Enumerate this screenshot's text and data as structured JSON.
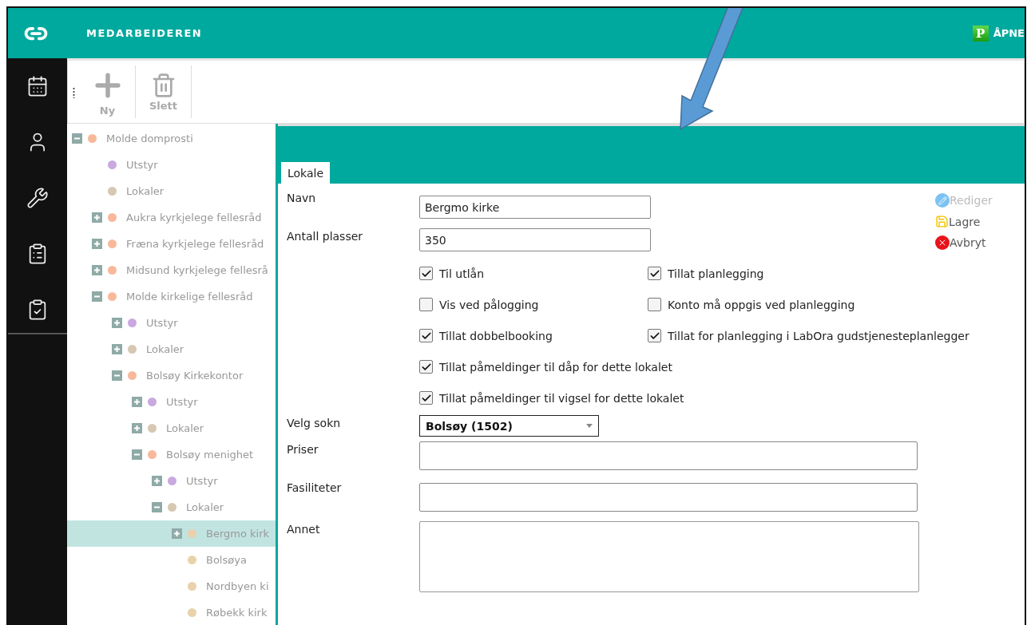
{
  "header": {
    "title": "MEDARBEIDEREN",
    "badge": "P",
    "action": "ÅPNE"
  },
  "toolbar": [
    {
      "kind": "add",
      "label": "Ny"
    },
    {
      "kind": "delete",
      "label": "Slett"
    }
  ],
  "sidebar": {
    "items": [
      {
        "kind": "calendar"
      },
      {
        "kind": "user"
      },
      {
        "kind": "wrench"
      },
      {
        "kind": "report"
      },
      {
        "kind": "checklist"
      }
    ]
  },
  "tree": [
    {
      "label": "Molde domprosti",
      "color": "#f8b99b",
      "expanded": true,
      "selected": false,
      "children": [
        {
          "label": "Utstyr",
          "color": "#c9a9e0",
          "selected": false
        },
        {
          "label": "Lokaler",
          "color": "#d6c8b2",
          "selected": false
        },
        {
          "label": "Aukra kyrkjelege fellesråd",
          "color": "#f8b99b",
          "expanded": false,
          "selected": false
        },
        {
          "label": "Fræna kyrkjelege fellesråd",
          "color": "#f8b99b",
          "expanded": false,
          "selected": false
        },
        {
          "label": "Midsund kyrkjelege fellesrå",
          "color": "#f8b99b",
          "expanded": false,
          "selected": false
        },
        {
          "label": "Molde kirkelige fellesråd",
          "color": "#f8b99b",
          "expanded": true,
          "selected": false,
          "children": [
            {
              "label": "Utstyr",
              "color": "#c9a9e0",
              "expanded": false,
              "selected": false
            },
            {
              "label": "Lokaler",
              "color": "#d6c8b2",
              "expanded": false,
              "selected": false
            },
            {
              "label": "Bolsøy Kirkekontor",
              "color": "#f8b99b",
              "expanded": true,
              "selected": false,
              "children": [
                {
                  "label": "Utstyr",
                  "color": "#c9a9e0",
                  "expanded": false,
                  "selected": false
                },
                {
                  "label": "Lokaler",
                  "color": "#d6c8b2",
                  "expanded": false,
                  "selected": false
                },
                {
                  "label": "Bolsøy menighet",
                  "color": "#f8b99b",
                  "expanded": true,
                  "selected": false,
                  "children": [
                    {
                      "label": "Utstyr",
                      "color": "#c9a9e0",
                      "expanded": false,
                      "selected": false
                    },
                    {
                      "label": "Lokaler",
                      "color": "#d6c8b2",
                      "expanded": true,
                      "selected": false,
                      "children": [
                        {
                          "label": "Bergmo kirk",
                          "color": "#e9d2ab",
                          "expanded": false,
                          "selected": true
                        },
                        {
                          "label": "Bolsøya",
                          "color": "#e9d2ab",
                          "selected": false
                        },
                        {
                          "label": "Nordbyen ki",
                          "color": "#e9d2ab",
                          "selected": false
                        },
                        {
                          "label": "Røbekk kirk",
                          "color": "#e9d2ab",
                          "selected": false
                        }
                      ]
                    }
                  ]
                }
              ]
            }
          ]
        }
      ]
    }
  ],
  "form": {
    "tabs": [
      {
        "label": "Lokale",
        "selected": true
      }
    ],
    "fields_top": [
      {
        "label": "Navn",
        "value": "Bergmo kirke"
      },
      {
        "label": "Antall plasser",
        "value": "350"
      }
    ],
    "actions": [
      {
        "kind": "edit",
        "label": "Rediger",
        "disabled": true
      },
      {
        "kind": "save",
        "label": "Lagre",
        "disabled": false
      },
      {
        "kind": "cancel",
        "label": "Avbryt",
        "disabled": false
      }
    ],
    "options": [
      {
        "label": "Til utlån",
        "checked": true,
        "wide": false
      },
      {
        "label": "Tillat planlegging",
        "checked": true,
        "wide": false
      },
      {
        "label": "Vis ved pålogging",
        "checked": false,
        "wide": false
      },
      {
        "label": "Konto må oppgis ved planlegging",
        "checked": false,
        "wide": false
      },
      {
        "label": "Tillat dobbelbooking",
        "checked": true,
        "wide": false
      },
      {
        "label": "Tillat for planlegging i LabOra gudstjenesteplanlegger",
        "checked": true,
        "wide": false
      },
      {
        "label": "Tillat påmeldinger til dåp for dette lokalet",
        "checked": true,
        "wide": true
      },
      {
        "label": "Tillat påmeldinger til vigsel for dette lokalet",
        "checked": true,
        "wide": true
      }
    ],
    "fields_bottom": [
      {
        "label": "Velg sokn",
        "kind": "select",
        "value": "Bolsøy (1502)"
      },
      {
        "label": "Priser",
        "kind": "text"
      },
      {
        "label": "Fasiliteter",
        "kind": "text"
      },
      {
        "label": "Annet",
        "kind": "textarea"
      }
    ]
  }
}
